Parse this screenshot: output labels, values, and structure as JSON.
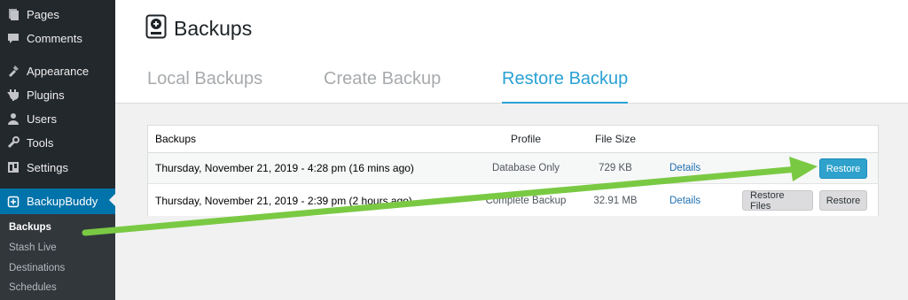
{
  "sidebar": {
    "items": [
      {
        "label": "Pages",
        "icon": "pages-icon"
      },
      {
        "label": "Comments",
        "icon": "comments-icon"
      },
      {
        "label": "Appearance",
        "icon": "appearance-icon"
      },
      {
        "label": "Plugins",
        "icon": "plugins-icon"
      },
      {
        "label": "Users",
        "icon": "users-icon"
      },
      {
        "label": "Tools",
        "icon": "tools-icon"
      },
      {
        "label": "Settings",
        "icon": "settings-icon"
      },
      {
        "label": "BackupBuddy",
        "icon": "backupbuddy-icon"
      }
    ],
    "submenu": [
      "Backups",
      "Stash Live",
      "Destinations",
      "Schedules"
    ]
  },
  "header": {
    "title": "Backups",
    "tabs": [
      "Local Backups",
      "Create Backup",
      "Restore Backup"
    ],
    "active_tab": "Restore Backup"
  },
  "table": {
    "columns": [
      "Backups",
      "Profile",
      "File Size"
    ],
    "rows": [
      {
        "backup": "Thursday, November 21, 2019 - 4:28 pm (16 mins ago)",
        "profile": "Database Only",
        "size": "729 KB",
        "details": "Details",
        "restore": "Restore"
      },
      {
        "backup": "Thursday, November 21, 2019 - 2:39 pm (2 hours ago)",
        "profile": "Complete Backup",
        "size": "32.91 MB",
        "details": "Details",
        "restore_files": "Restore Files",
        "restore": "Restore"
      }
    ]
  },
  "colors": {
    "sidebar_bg": "#23282d",
    "active_menu": "#0073aa",
    "accent_tab": "#2aa1d3",
    "primary_button": "#2ea2cc",
    "annotation_arrow": "#7ac943"
  }
}
